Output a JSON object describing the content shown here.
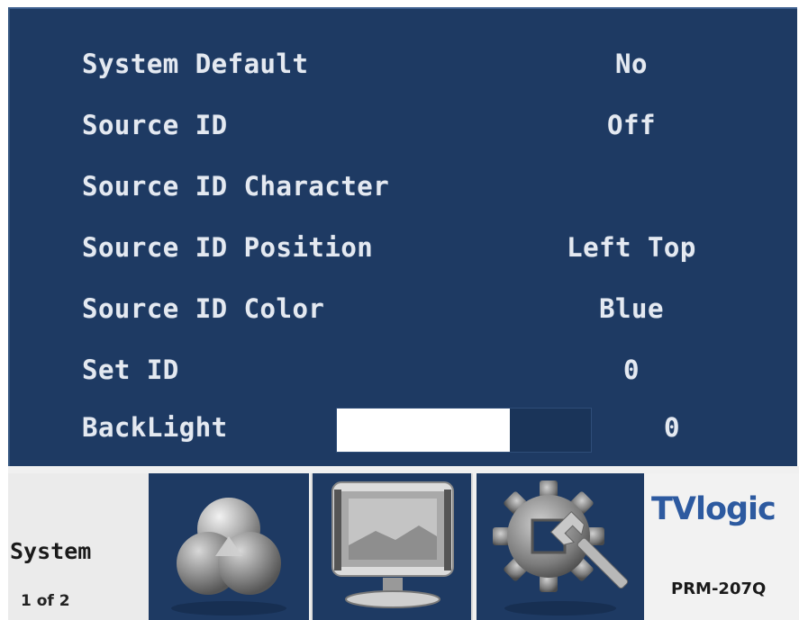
{
  "menu": {
    "rows": [
      {
        "label": "System Default",
        "value": "No"
      },
      {
        "label": "Source ID",
        "value": "Off"
      },
      {
        "label": "Source ID Character",
        "value": ""
      },
      {
        "label": "Source ID Position",
        "value": "Left Top"
      },
      {
        "label": "Source ID Color",
        "value": "Blue"
      },
      {
        "label": "Set ID",
        "value": "0"
      }
    ],
    "backlight": {
      "label": "BackLight",
      "value": "0",
      "level_fraction": 0.68
    }
  },
  "tabs": {
    "system_label": "System",
    "page_indicator": "1 of 2",
    "icons": [
      "color-circles-icon",
      "monitor-icon",
      "gear-wrench-icon"
    ]
  },
  "brand": {
    "logo": "TVlogic",
    "model": "PRM-207Q"
  },
  "colors": {
    "panel": "#1e3a63",
    "text": "#e4e9f1",
    "logo_blue": "#2d5aa0"
  }
}
